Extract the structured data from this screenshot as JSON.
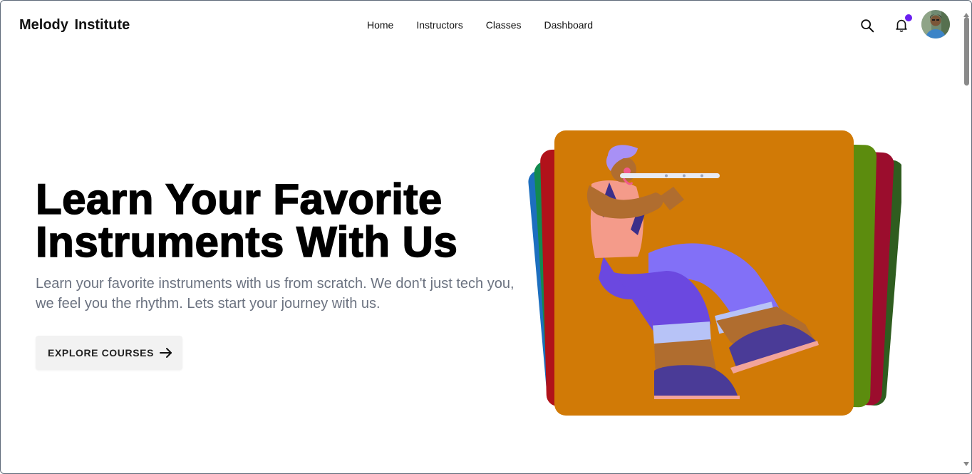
{
  "header": {
    "brand": "Melody  Institute",
    "nav": [
      {
        "label": "Home"
      },
      {
        "label": "Instructors"
      },
      {
        "label": "Classes"
      },
      {
        "label": "Dashboard"
      }
    ],
    "notification_dot_color": "#6a1ff0"
  },
  "hero": {
    "title_line1": "Learn Your Favorite",
    "title_line2": "Instruments With Us",
    "subtitle_line1": "Learn your favorite instruments with us from scratch. We don't just tech you,",
    "subtitle_line2": "we feel you the rhythm. Lets start your journey with us.",
    "cta_label": "EXPLORE COURSES",
    "cta_icon": "arrow-right-icon"
  },
  "illustration": {
    "subject": "flute-player-icon",
    "card_color": "#d17a06",
    "stack_colors": [
      "#1d6fbf",
      "#138a4f",
      "#b1121a",
      "#5c8c0e",
      "#9b0d2d",
      "#2f5d1f"
    ]
  },
  "icons": {
    "search": "search-icon",
    "notifications": "bell-icon",
    "profile": "avatar"
  }
}
